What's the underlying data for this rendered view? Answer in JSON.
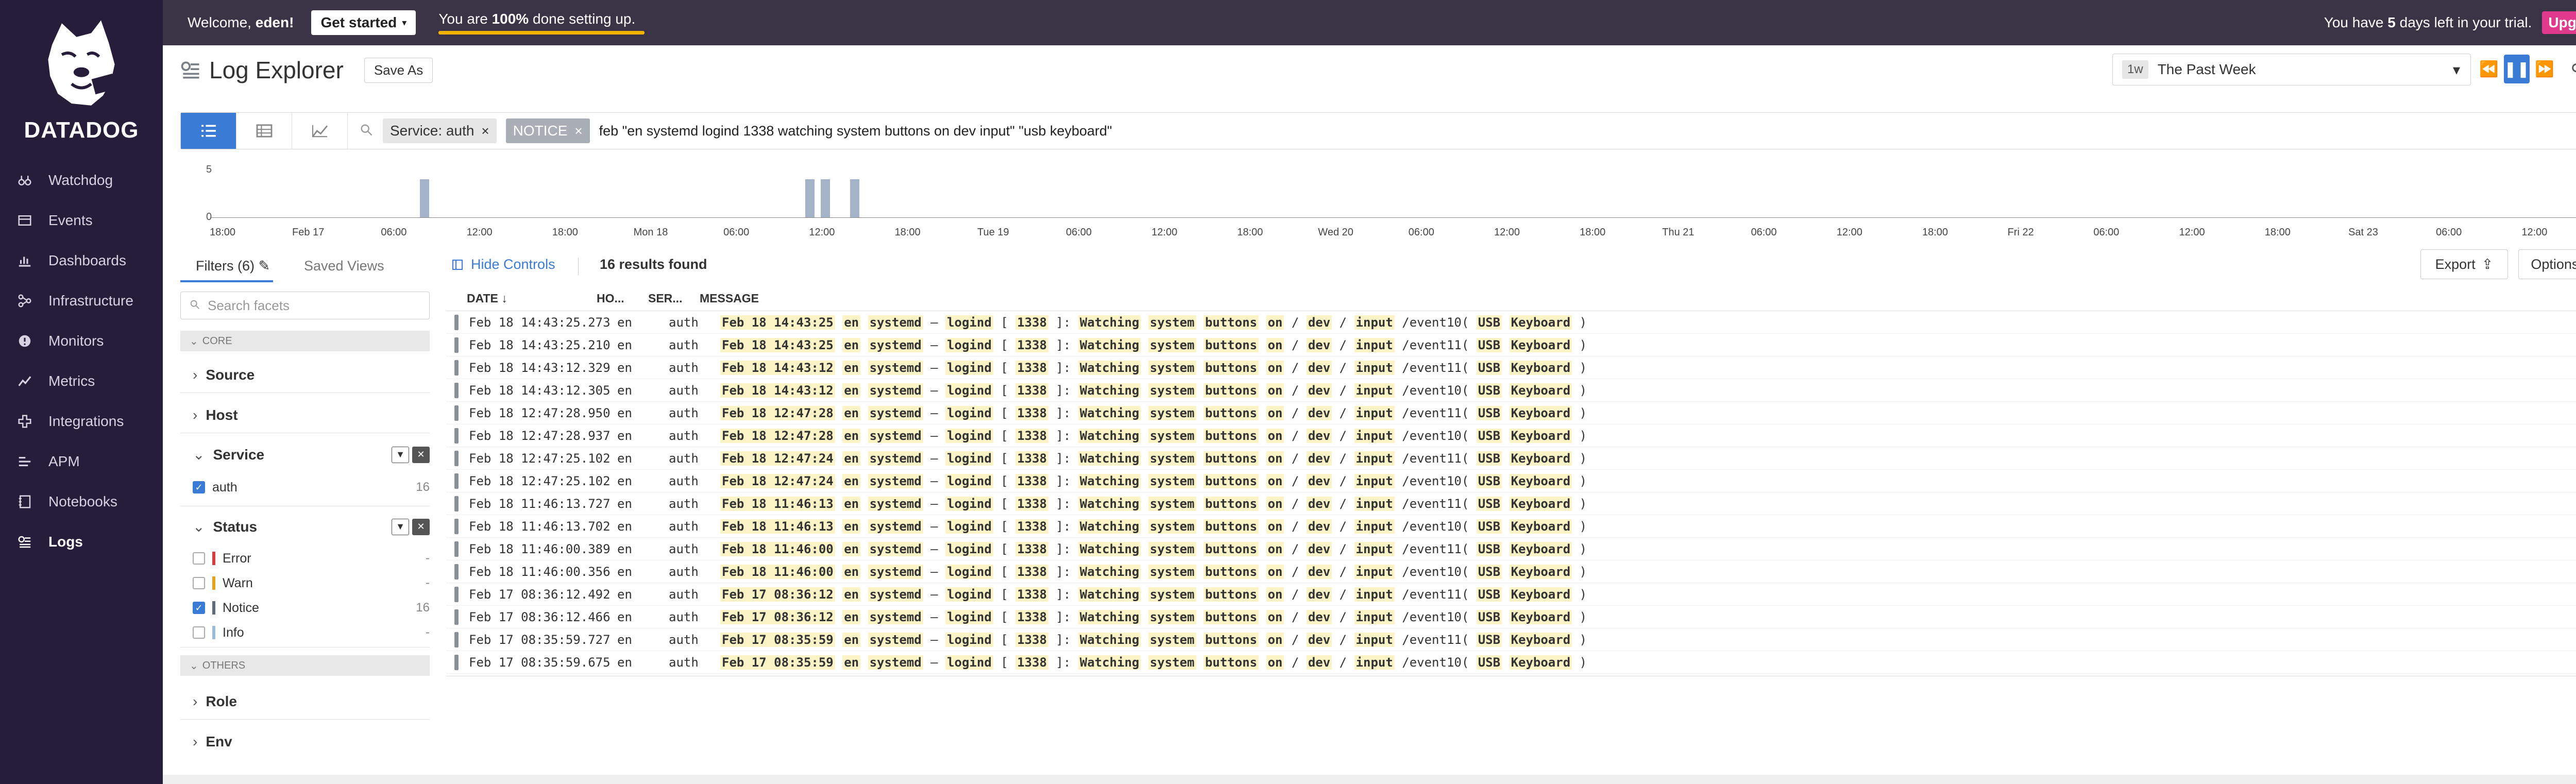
{
  "brand": {
    "name": "DATADOG"
  },
  "nav": [
    {
      "label": "Watchdog",
      "icon": "binoculars-icon"
    },
    {
      "label": "Events",
      "icon": "events-icon"
    },
    {
      "label": "Dashboards",
      "icon": "dashboards-icon"
    },
    {
      "label": "Infrastructure",
      "icon": "infrastructure-icon"
    },
    {
      "label": "Monitors",
      "icon": "monitors-icon"
    },
    {
      "label": "Metrics",
      "icon": "metrics-icon"
    },
    {
      "label": "Integrations",
      "icon": "integrations-icon"
    },
    {
      "label": "APM",
      "icon": "apm-icon"
    },
    {
      "label": "Notebooks",
      "icon": "notebooks-icon"
    },
    {
      "label": "Logs",
      "icon": "logs-icon"
    }
  ],
  "topbar": {
    "welcome_prefix": "Welcome, ",
    "user": "eden!",
    "get_started": "Get started",
    "setup_pre": "You are ",
    "setup_pct": "100%",
    "setup_post": " done setting up.",
    "setup_progress": 1.0,
    "trial_pre": "You have ",
    "trial_days": "5",
    "trial_post": " days left in your trial.",
    "upgrade": "Upgrade",
    "accent": "#e13a8d"
  },
  "header": {
    "title": "Log Explorer",
    "save_as": "Save As",
    "time_badge": "1w",
    "time_label": "The Past Week"
  },
  "search": {
    "pills": [
      {
        "label": "Service: auth",
        "close": "×"
      },
      {
        "label": "NOTICE",
        "close": "×"
      }
    ],
    "query": "feb \"en systemd logind 1338 watching system buttons on dev input\" \"usb keyboard\""
  },
  "histogram": {
    "y_ticks": [
      "5",
      "0"
    ],
    "x_ticks": [
      "18:00",
      "Feb 17",
      "06:00",
      "12:00",
      "18:00",
      "Mon 18",
      "06:00",
      "12:00",
      "18:00",
      "Tue 19",
      "06:00",
      "12:00",
      "18:00",
      "Wed 20",
      "06:00",
      "12:00",
      "18:00",
      "Thu 21",
      "06:00",
      "12:00",
      "18:00",
      "Fri 22",
      "06:00",
      "12:00",
      "18:00",
      "Sat 23",
      "06:00",
      "12:00"
    ],
    "bars": [
      {
        "slot": 2.36,
        "value": 4
      },
      {
        "slot": 6.86,
        "value": 4
      },
      {
        "slot": 7.04,
        "value": 4
      },
      {
        "slot": 7.38,
        "value": 4
      }
    ],
    "y_max": 5
  },
  "facets": {
    "tab_filters": "Filters (6)",
    "tab_saved": "Saved Views",
    "search_placeholder": "Search facets",
    "core_label": "CORE",
    "others_label": "OTHERS",
    "source": "Source",
    "host": "Host",
    "service": "Service",
    "service_values": [
      {
        "label": "auth",
        "count": "16",
        "checked": true
      }
    ],
    "status": "Status",
    "status_values": [
      {
        "label": "Error",
        "count": "-",
        "checked": false,
        "color": "#d33d3d"
      },
      {
        "label": "Warn",
        "count": "-",
        "checked": false,
        "color": "#e5a21a"
      },
      {
        "label": "Notice",
        "count": "16",
        "checked": true,
        "color": "#5f6a78"
      },
      {
        "label": "Info",
        "count": "-",
        "checked": false,
        "color": "#9fb9d8"
      }
    ],
    "role": "Role",
    "env": "Env"
  },
  "results": {
    "hide_controls": "Hide Controls",
    "found": "16 results found",
    "export": "Export",
    "options": "Options",
    "columns": {
      "date": "DATE ↓",
      "host": "HO...",
      "service": "SER...",
      "message": "MESSAGE"
    }
  },
  "rows": [
    {
      "date": "Feb 18 14:43:25.273",
      "host": "en",
      "service": "auth",
      "ts": "Feb 18 14:43:25",
      "event": "/event10"
    },
    {
      "date": "Feb 18 14:43:25.210",
      "host": "en",
      "service": "auth",
      "ts": "Feb 18 14:43:25",
      "event": "/event11"
    },
    {
      "date": "Feb 18 14:43:12.329",
      "host": "en",
      "service": "auth",
      "ts": "Feb 18 14:43:12",
      "event": "/event11"
    },
    {
      "date": "Feb 18 14:43:12.305",
      "host": "en",
      "service": "auth",
      "ts": "Feb 18 14:43:12",
      "event": "/event10"
    },
    {
      "date": "Feb 18 12:47:28.950",
      "host": "en",
      "service": "auth",
      "ts": "Feb 18 12:47:28",
      "event": "/event11"
    },
    {
      "date": "Feb 18 12:47:28.937",
      "host": "en",
      "service": "auth",
      "ts": "Feb 18 12:47:28",
      "event": "/event10"
    },
    {
      "date": "Feb 18 12:47:25.102",
      "host": "en",
      "service": "auth",
      "ts": "Feb 18 12:47:24",
      "event": "/event11"
    },
    {
      "date": "Feb 18 12:47:25.102",
      "host": "en",
      "service": "auth",
      "ts": "Feb 18 12:47:24",
      "event": "/event10"
    },
    {
      "date": "Feb 18 11:46:13.727",
      "host": "en",
      "service": "auth",
      "ts": "Feb 18 11:46:13",
      "event": "/event11"
    },
    {
      "date": "Feb 18 11:46:13.702",
      "host": "en",
      "service": "auth",
      "ts": "Feb 18 11:46:13",
      "event": "/event10"
    },
    {
      "date": "Feb 18 11:46:00.389",
      "host": "en",
      "service": "auth",
      "ts": "Feb 18 11:46:00",
      "event": "/event11"
    },
    {
      "date": "Feb 18 11:46:00.356",
      "host": "en",
      "service": "auth",
      "ts": "Feb 18 11:46:00",
      "event": "/event10"
    },
    {
      "date": "Feb 17 08:36:12.492",
      "host": "en",
      "service": "auth",
      "ts": "Feb 17 08:36:12",
      "event": "/event11"
    },
    {
      "date": "Feb 17 08:36:12.466",
      "host": "en",
      "service": "auth",
      "ts": "Feb 17 08:36:12",
      "event": "/event10"
    },
    {
      "date": "Feb 17 08:35:59.727",
      "host": "en",
      "service": "auth",
      "ts": "Feb 17 08:35:59",
      "event": "/event11"
    },
    {
      "date": "Feb 17 08:35:59.675",
      "host": "en",
      "service": "auth",
      "ts": "Feb 17 08:35:59",
      "event": "/event10"
    }
  ],
  "message_tokens": {
    "host": "en",
    "proc": "systemd",
    "dash": "–",
    "unit": "logind",
    "lb": "[",
    "pid": "1338",
    "rb": "]:",
    "w1": "Watching",
    "w2": "system",
    "w3": "buttons",
    "w4": "on",
    "slash": "/",
    "dev": "dev",
    "input": "input",
    "lp": "(",
    "usb": "USB",
    "kb": "Keyboard",
    "rp": ")"
  }
}
